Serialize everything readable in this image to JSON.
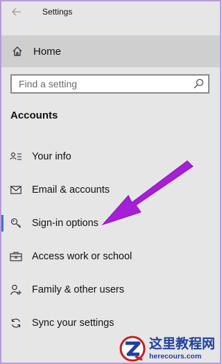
{
  "window": {
    "title": "Settings"
  },
  "home": {
    "label": "Home"
  },
  "search": {
    "placeholder": "Find a setting",
    "value": ""
  },
  "section": {
    "title": "Accounts"
  },
  "nav": {
    "items": [
      {
        "label": "Your info",
        "icon": "person-card-icon",
        "selected": false
      },
      {
        "label": "Email & accounts",
        "icon": "mail-icon",
        "selected": false
      },
      {
        "label": "Sign-in options",
        "icon": "key-icon",
        "selected": true
      },
      {
        "label": "Access work or school",
        "icon": "briefcase-icon",
        "selected": false
      },
      {
        "label": "Family & other users",
        "icon": "person-add-icon",
        "selected": false
      },
      {
        "label": "Sync your settings",
        "icon": "sync-icon",
        "selected": false
      }
    ]
  },
  "annotation": {
    "color": "#a51fd6"
  },
  "watermark": {
    "cn_text": "这里教程网",
    "url": "herecours.com"
  },
  "colors": {
    "accent": "#3d6fd8",
    "hover_bg": "#cfcfcf",
    "frame": "#b79ad8"
  }
}
